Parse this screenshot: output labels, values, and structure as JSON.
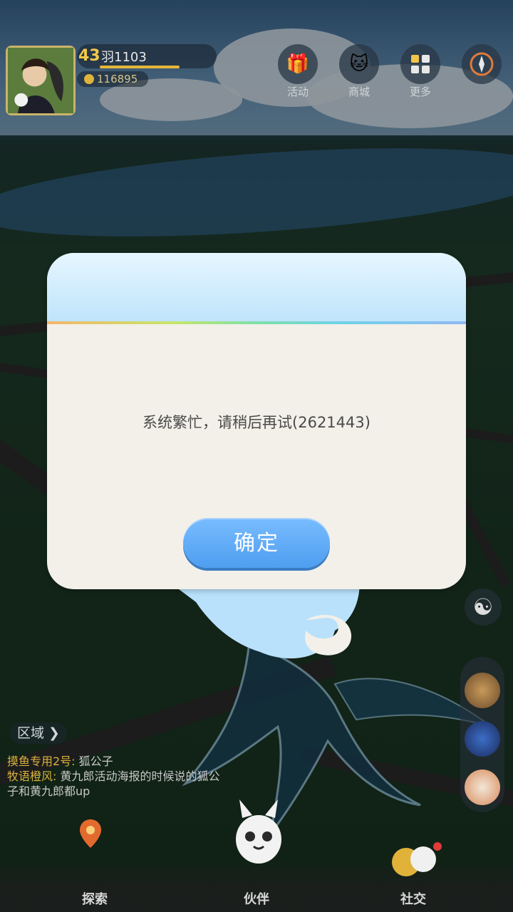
{
  "player": {
    "level": "43",
    "name": "羽1103",
    "coins": "116895"
  },
  "top_menu": [
    {
      "label": "活动",
      "icon": "gift-icon"
    },
    {
      "label": "商城",
      "icon": "shop-cat-icon"
    },
    {
      "label": "更多",
      "icon": "more-grid-icon"
    },
    {
      "label": "",
      "icon": "compass-icon"
    }
  ],
  "region": {
    "label": "区域"
  },
  "chat": [
    {
      "name": "摸鱼专用2号:",
      "text": " 狐公子"
    },
    {
      "name": "牧语橙风:",
      "text": " 黄九郎活动海报的时候说的狐公子和黄九郎都up"
    }
  ],
  "dialog": {
    "message": "系统繁忙，请稍后再试(2621443)",
    "confirm_label": "确定"
  },
  "bottom_nav": [
    {
      "label": "探索",
      "icon": "map-pin-icon"
    },
    {
      "label": "伙伴",
      "icon": "companion-icon"
    },
    {
      "label": "社交",
      "icon": "social-icon"
    }
  ],
  "colors": {
    "confirm_button": "#4e9ef0",
    "dialog_bg": "#f2f0e9",
    "header_bg": "#bfe4fb",
    "level_gold": "#f2c84a"
  }
}
